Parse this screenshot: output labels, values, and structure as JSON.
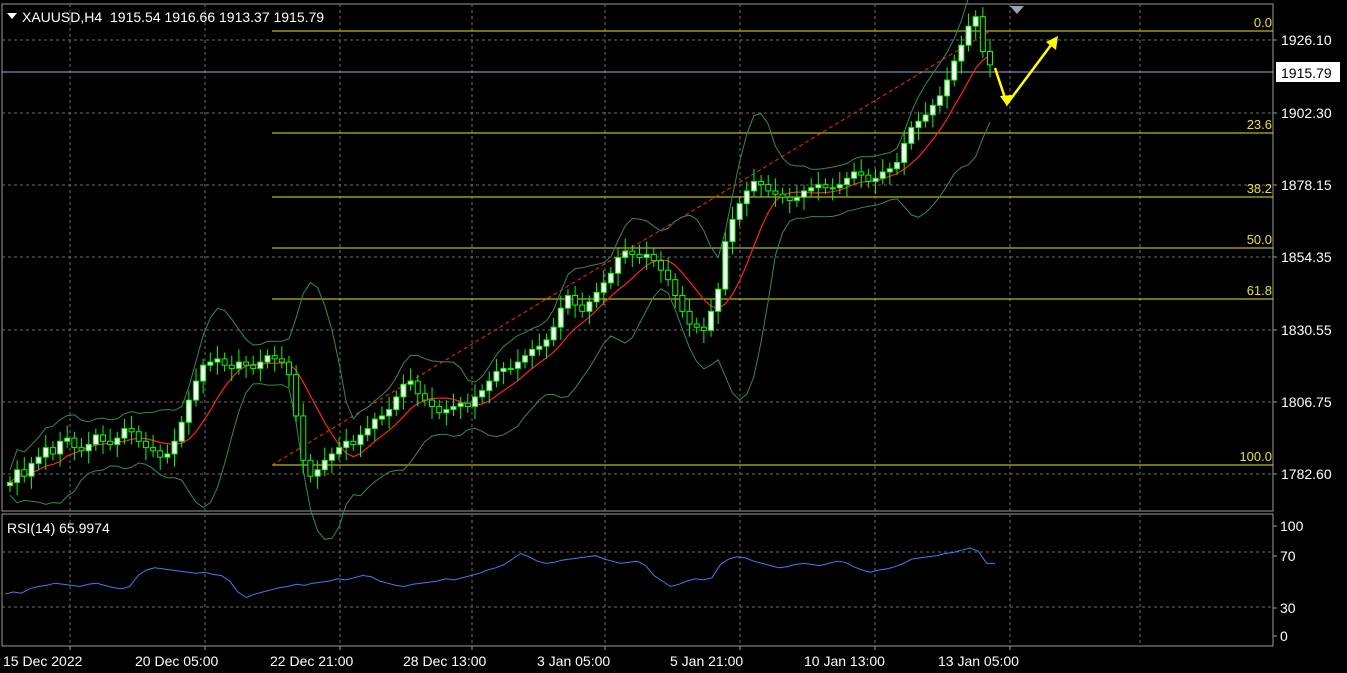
{
  "header": {
    "symbol_timeframe": "XAUUSD,H4",
    "ohlc": "1915.54 1916.66 1913.37 1915.79",
    "dropdown_icon": "triangle-down-icon"
  },
  "price_axis": {
    "labels": [
      "1926.10",
      "1902.30",
      "1878.15",
      "1854.35",
      "1830.55",
      "1806.75",
      "1782.60"
    ],
    "current_price": "1915.79"
  },
  "fibonacci": {
    "levels": [
      "0.0",
      "23.6",
      "38.2",
      "50.0",
      "61.8",
      "100.0"
    ],
    "color": "#e8e41c"
  },
  "rsi": {
    "label": "RSI(14) 65.9974",
    "axis_labels": [
      "100",
      "70",
      "30",
      "0"
    ],
    "color": "#3a7ff0"
  },
  "time_axis": {
    "labels": [
      "15 Dec 2022",
      "20 Dec 05:00",
      "22 Dec 21:00",
      "28 Dec 13:00",
      "3 Jan 05:00",
      "5 Jan 21:00",
      "10 Jan 13:00",
      "13 Jan 05:00"
    ]
  },
  "colors": {
    "background": "#000000",
    "grid": "#6b6b6b",
    "candle": "#00ff00",
    "bull_body": "#ffffff",
    "moving_average": "#ff2020",
    "bands": "#2e8b57",
    "arrows": "#ffff00"
  },
  "chart_data": {
    "type": "candlestick",
    "symbol": "XAUUSD",
    "timeframe": "H4",
    "ylim": [
      1775,
      1935
    ],
    "x_tick_labels": [
      "15 Dec 2022",
      "20 Dec 05:00",
      "22 Dec 21:00",
      "28 Dec 13:00",
      "3 Jan 05:00",
      "5 Jan 21:00",
      "10 Jan 13:00",
      "13 Jan 05:00"
    ],
    "y_tick_labels": [
      "1926.10",
      "1902.30",
      "1878.15",
      "1854.35",
      "1830.55",
      "1806.75",
      "1782.60"
    ],
    "last_close": 1915.79,
    "last_bar": {
      "open": 1915.54,
      "high": 1916.66,
      "low": 1913.37,
      "close": 1915.79
    },
    "close_series": [
      1784,
      1788,
      1786,
      1790,
      1792,
      1795,
      1793,
      1797,
      1798,
      1795,
      1794,
      1796,
      1799,
      1797,
      1796,
      1798,
      1801,
      1800,
      1797,
      1795,
      1794,
      1792,
      1793,
      1797,
      1803,
      1810,
      1816,
      1821,
      1822,
      1823,
      1821,
      1820,
      1822,
      1821,
      1820,
      1822,
      1824,
      1823,
      1822,
      1818,
      1805,
      1791,
      1786,
      1788,
      1791,
      1793,
      1795,
      1797,
      1796,
      1799,
      1801,
      1804,
      1805,
      1807,
      1811,
      1815,
      1816,
      1812,
      1810,
      1808,
      1806,
      1807,
      1808,
      1809,
      1808,
      1811,
      1813,
      1816,
      1819,
      1820,
      1820,
      1822,
      1824,
      1826,
      1827,
      1829,
      1833,
      1839,
      1843,
      1840,
      1838,
      1841,
      1844,
      1847,
      1850,
      1855,
      1857,
      1856,
      1855,
      1856,
      1854,
      1851,
      1848,
      1843,
      1838,
      1834,
      1833,
      1832,
      1838,
      1845,
      1860,
      1867,
      1872,
      1876,
      1879,
      1878,
      1876,
      1875,
      1874,
      1873,
      1874,
      1876,
      1877,
      1878,
      1877,
      1877,
      1878,
      1880,
      1882,
      1881,
      1879,
      1880,
      1882,
      1883,
      1885,
      1891,
      1896,
      1898,
      1900,
      1903,
      1906,
      1911,
      1917,
      1922,
      1928,
      1931,
      1920,
      1915.79
    ],
    "rsi_series": [
      38,
      40,
      39,
      43,
      45,
      46,
      48,
      47,
      46,
      45,
      47,
      48,
      46,
      44,
      43,
      45,
      55,
      60,
      62,
      61,
      60,
      59,
      58,
      57,
      58,
      56,
      55,
      50,
      40,
      35,
      38,
      40,
      42,
      44,
      45,
      47,
      46,
      48,
      49,
      50,
      52,
      51,
      53,
      55,
      54,
      50,
      48,
      46,
      45,
      47,
      48,
      49,
      50,
      52,
      51,
      53,
      55,
      57,
      60,
      62,
      65,
      70,
      75,
      72,
      68,
      66,
      67,
      69,
      70,
      71,
      72,
      73,
      70,
      68,
      66,
      67,
      68,
      64,
      55,
      50,
      45,
      47,
      50,
      52,
      51,
      53,
      65,
      70,
      72,
      71,
      68,
      66,
      64,
      62,
      63,
      65,
      66,
      65,
      64,
      66,
      68,
      67,
      63,
      60,
      58,
      60,
      61,
      63,
      66,
      70,
      71,
      72,
      73,
      75,
      76,
      78,
      80,
      77,
      66,
      65.9974
    ],
    "fibonacci_retracement": {
      "levels": [
        0.0,
        23.6,
        38.2,
        50.0,
        61.8,
        100.0
      ]
    },
    "rsi": {
      "period": 14,
      "value": 65.9974,
      "levels": [
        100,
        70,
        30,
        0
      ]
    },
    "indicators": [
      "Bollinger Bands",
      "Moving Average"
    ]
  }
}
